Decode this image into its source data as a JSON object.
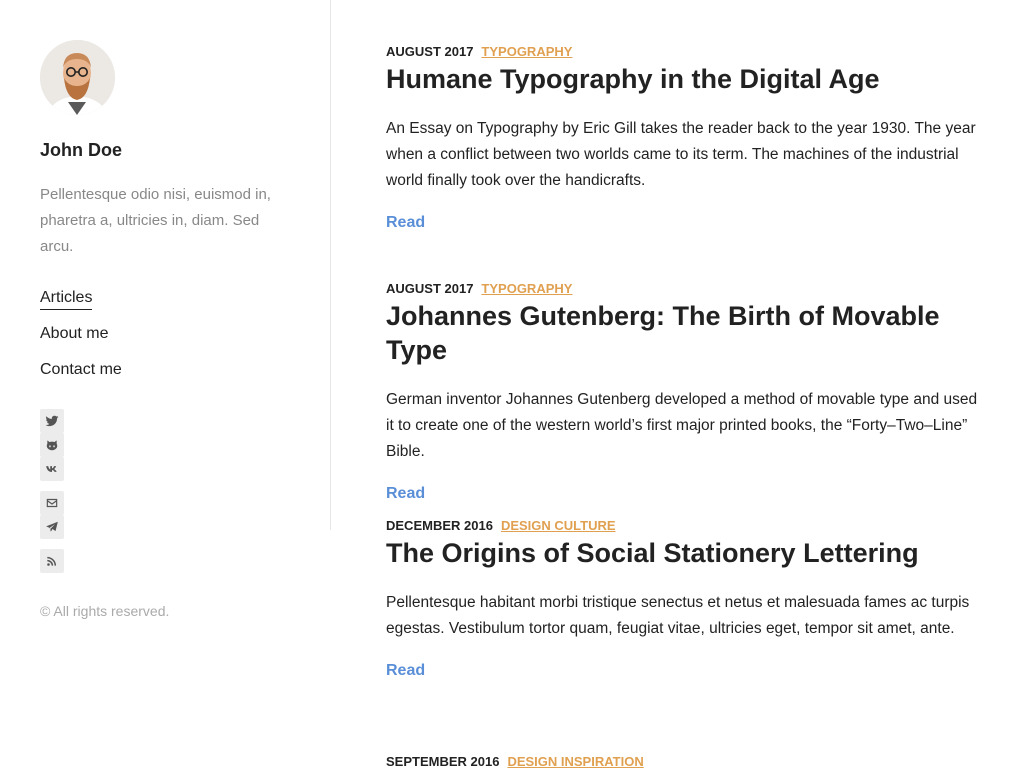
{
  "author": {
    "name": "John Doe",
    "bio": "Pellentesque odio nisi, euismod in, pharetra a, ultricies in, diam. Sed arcu."
  },
  "menu": [
    {
      "label": "Articles",
      "active": true
    },
    {
      "label": "About me",
      "active": false
    },
    {
      "label": "Contact me",
      "active": false
    }
  ],
  "social": [
    "twitter-icon",
    "github-icon",
    "vk-icon",
    "email-icon",
    "telegram-icon",
    "rss-icon"
  ],
  "copyright": "© All rights reserved.",
  "colors": {
    "category": "#e0a050",
    "link": "#5a8fd8",
    "muted": "#888888"
  },
  "posts": [
    {
      "date": "AUGUST 2017",
      "category": "TYPOGRAPHY",
      "title": "Humane Typography in the Digital Age",
      "excerpt": "An Essay on Typography by Eric Gill takes the reader back to the year 1930. The year when a conflict between two worlds came to its term. The machines of the industrial world finally took over the handicrafts.",
      "read": "Read"
    },
    {
      "date": "AUGUST 2017",
      "category": "TYPOGRAPHY",
      "title": "Johannes Gutenberg: The Birth of Movable Type",
      "excerpt": "German inventor Johannes Gutenberg developed a method of movable type and used it to create one of the western world’s first major printed books, the “Forty–Two–Line” Bible.",
      "read": "Read"
    },
    {
      "date": "DECEMBER 2016",
      "category": "DESIGN CULTURE",
      "title": "The Origins of Social Stationery Lettering",
      "excerpt": "Pellentesque habitant morbi tristique senectus et netus et malesuada fames ac turpis egestas. Vestibulum tortor quam, feugiat vitae, ultricies eget, tempor sit amet, ante.",
      "read": "Read"
    },
    {
      "date": "SEPTEMBER 2016",
      "category": "DESIGN INSPIRATION"
    }
  ]
}
